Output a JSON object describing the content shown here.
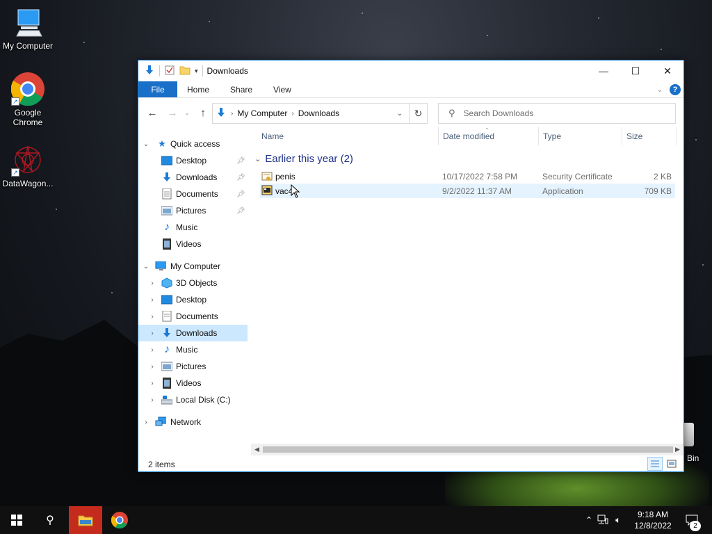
{
  "desktop": {
    "icons": [
      {
        "label": "My Computer",
        "icon": "monitor-icon"
      },
      {
        "label": "Google Chrome",
        "icon": "chrome-icon"
      },
      {
        "label": "DataWagon...",
        "icon": "datawagon-icon"
      }
    ],
    "recycle_bin_label": "Bin"
  },
  "window": {
    "title": "Downloads",
    "controls": {
      "minimize": "—",
      "maximize": "☐",
      "close": "✕"
    },
    "ribbon_tabs": [
      "File",
      "Home",
      "Share",
      "View"
    ],
    "breadcrumb": [
      "My Computer",
      "Downloads"
    ],
    "search_placeholder": "Search Downloads",
    "columns": [
      "Name",
      "Date modified",
      "Type",
      "Size"
    ],
    "group_label": "Earlier this year (2)",
    "files": [
      {
        "name": "penis",
        "date": "10/17/2022 7:58 PM",
        "type": "Security Certificate",
        "size": "2 KB",
        "icon": "certificate-icon",
        "selected": false
      },
      {
        "name": "vac4",
        "date": "9/2/2022 11:37 AM",
        "type": "Application",
        "size": "709 KB",
        "icon": "application-icon",
        "selected": true
      }
    ],
    "status": "2 items"
  },
  "navpane": {
    "quick_access": {
      "label": "Quick access",
      "items": [
        {
          "label": "Desktop",
          "pinned": true
        },
        {
          "label": "Downloads",
          "pinned": true
        },
        {
          "label": "Documents",
          "pinned": true
        },
        {
          "label": "Pictures",
          "pinned": true
        },
        {
          "label": "Music",
          "pinned": false
        },
        {
          "label": "Videos",
          "pinned": false
        }
      ]
    },
    "my_computer": {
      "label": "My Computer",
      "items": [
        "3D Objects",
        "Desktop",
        "Documents",
        "Downloads",
        "Music",
        "Pictures",
        "Videos",
        "Local Disk (C:)"
      ],
      "selected": "Downloads"
    },
    "network_label": "Network"
  },
  "taskbar": {
    "time": "9:18 AM",
    "date": "12/8/2022",
    "notification_count": "2",
    "accent": "#c42b1c"
  },
  "colors": {
    "accent": "#1a6fc9",
    "selection": "#cce8ff",
    "group_header": "#1e3287"
  }
}
